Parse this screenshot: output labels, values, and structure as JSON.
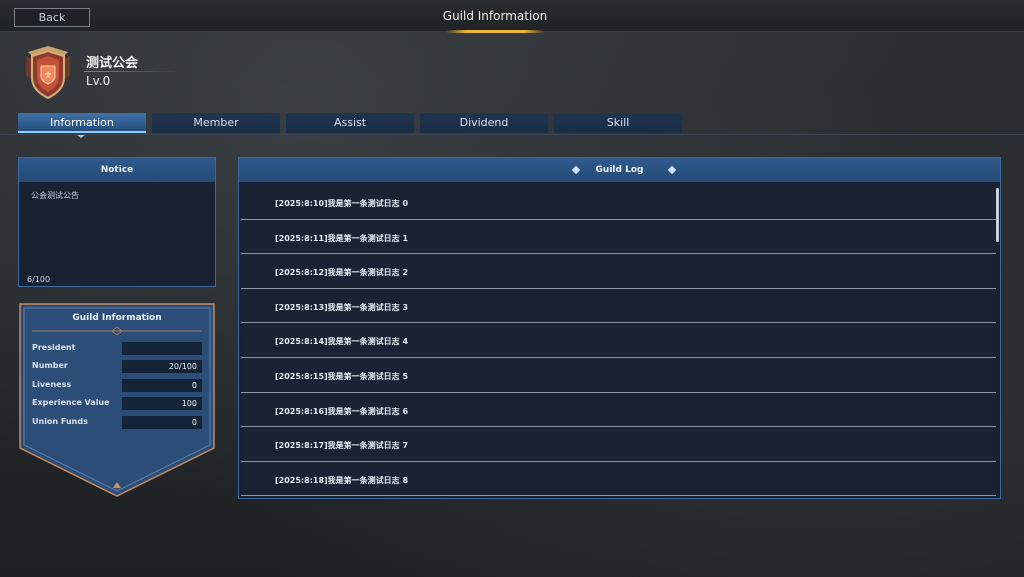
{
  "header": {
    "back_label": "Back",
    "title": "Guild Information"
  },
  "guild": {
    "name": "测试公会",
    "level": "Lv.0"
  },
  "tabs": [
    {
      "label": "Information",
      "active": true
    },
    {
      "label": "Member",
      "active": false
    },
    {
      "label": "Assist",
      "active": false
    },
    {
      "label": "Dividend",
      "active": false
    },
    {
      "label": "Skill",
      "active": false
    }
  ],
  "notice": {
    "title": "Notice",
    "text": "公会测试公告",
    "count": "6/100"
  },
  "guild_info": {
    "title": "Guild Information",
    "rows": [
      {
        "label": "President",
        "value": ""
      },
      {
        "label": "Number",
        "value": "20/100"
      },
      {
        "label": "Liveness",
        "value": "0"
      },
      {
        "label": "Experience Value",
        "value": "100"
      },
      {
        "label": "Union Funds",
        "value": "0"
      }
    ]
  },
  "guild_log": {
    "title": "Guild Log",
    "entries": [
      "[2025:8:10]我是第一条测试日志 0",
      "[2025:8:11]我是第一条测试日志 1",
      "[2025:8:12]我是第一条测试日志 2",
      "[2025:8:13]我是第一条测试日志 3",
      "[2025:8:14]我是第一条测试日志 4",
      "[2025:8:15]我是第一条测试日志 5",
      "[2025:8:16]我是第一条测试日志 6",
      "[2025:8:17]我是第一条测试日志 7",
      "[2025:8:18]我是第一条测试日志 8"
    ]
  },
  "colors": {
    "accent_gold": "#f0b237",
    "tab_active": "#3f73a8",
    "panel_header": "#2e5a8c"
  },
  "icons": {
    "emblem": "guild-shield-emblem-icon"
  }
}
